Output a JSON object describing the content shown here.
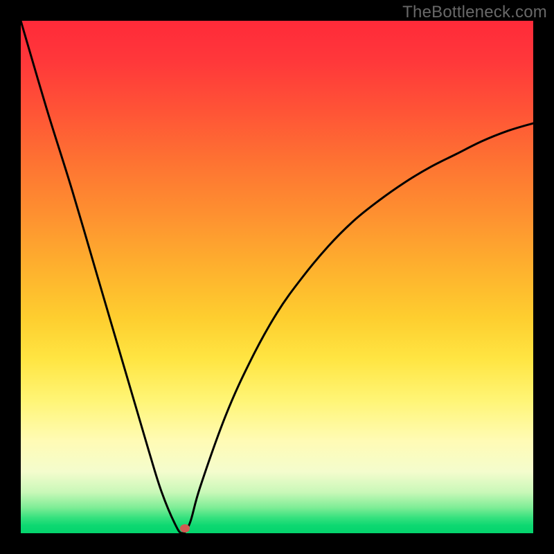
{
  "watermark": "TheBottleneck.com",
  "colors": {
    "curve": "#000000",
    "marker": "#d15a52",
    "frame": "#000000"
  },
  "chart_data": {
    "type": "line",
    "title": "",
    "xlabel": "",
    "ylabel": "",
    "xlim": [
      0,
      100
    ],
    "ylim": [
      0,
      100
    ],
    "grid": false,
    "legend": false,
    "series": [
      {
        "name": "bottleneck-curve",
        "x": [
          0,
          5,
          10,
          15,
          20,
          25,
          27.5,
          30,
          31.5,
          33,
          35,
          40,
          45,
          50,
          55,
          60,
          65,
          70,
          75,
          80,
          85,
          90,
          95,
          100
        ],
        "y": [
          100,
          83,
          67,
          50,
          33,
          16,
          8,
          2,
          0,
          2,
          9,
          23,
          34,
          43,
          50,
          56,
          61,
          65,
          68.5,
          71.5,
          74,
          76.5,
          78.5,
          80
        ]
      }
    ],
    "marker": {
      "x": 32.0,
      "y": 1.0
    }
  }
}
